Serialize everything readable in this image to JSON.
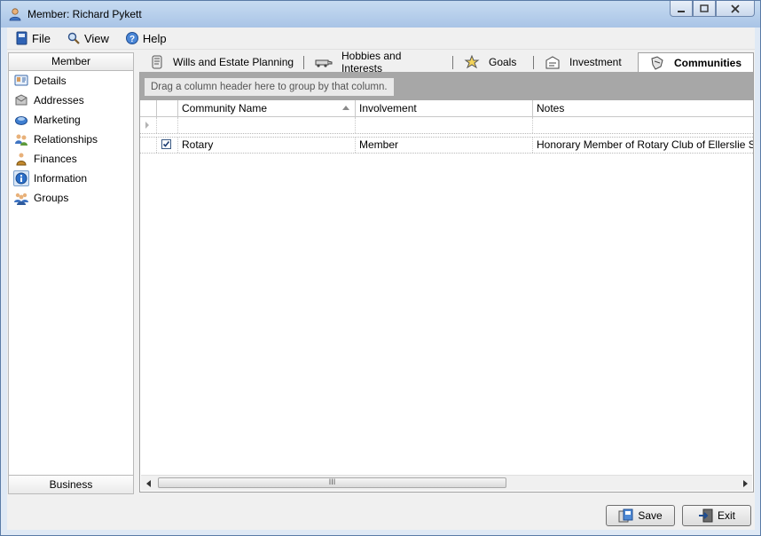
{
  "window": {
    "title": "Member: Richard Pykett"
  },
  "menu": {
    "file": "File",
    "view": "View",
    "help": "Help"
  },
  "sidebar": {
    "header": "Member",
    "footer": "Business",
    "items": [
      {
        "label": "Details",
        "icon": "details-icon"
      },
      {
        "label": "Addresses",
        "icon": "addresses-icon"
      },
      {
        "label": "Marketing",
        "icon": "marketing-icon"
      },
      {
        "label": "Relationships",
        "icon": "relationships-icon"
      },
      {
        "label": "Finances",
        "icon": "finances-icon"
      },
      {
        "label": "Information",
        "icon": "information-icon",
        "selected": true
      },
      {
        "label": "Groups",
        "icon": "groups-icon"
      }
    ]
  },
  "tabs": [
    {
      "label": "Wills and Estate Planning",
      "icon": "wills-icon"
    },
    {
      "label": "Hobbies and Interests",
      "icon": "hobbies-icon"
    },
    {
      "label": "Goals",
      "icon": "goals-icon"
    },
    {
      "label": "Investment",
      "icon": "investment-icon"
    },
    {
      "label": "Communities",
      "icon": "communities-icon",
      "active": true
    }
  ],
  "grid": {
    "group_hint": "Drag a column header here to group by that column.",
    "columns": [
      "Community Name",
      "Involvement",
      "Notes"
    ],
    "rows": [
      {
        "checked": true,
        "community": "Rotary",
        "involvement": "Member",
        "notes": "Honorary Member of Rotary Club of Ellerslie Sunrise"
      }
    ],
    "scroll_grip": "III"
  },
  "buttons": {
    "save": "Save",
    "exit": "Exit"
  }
}
